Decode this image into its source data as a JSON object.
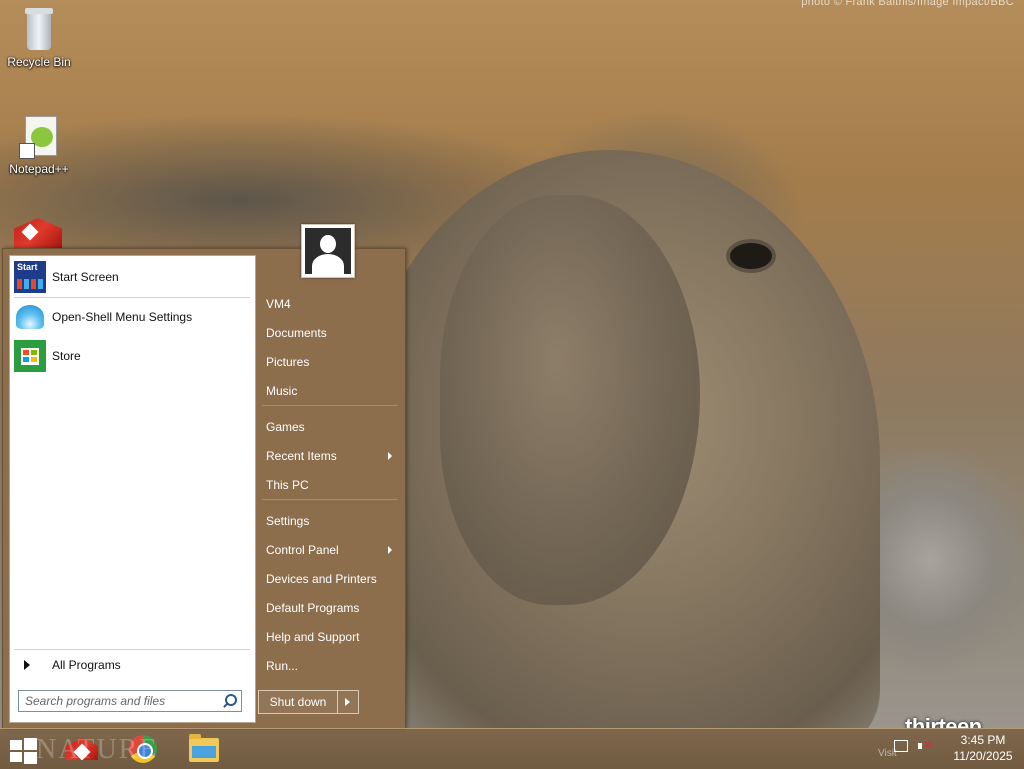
{
  "desktop": {
    "photo_credit": "photo © Frank Balthis/Image Impact/BBC",
    "watermark": "thirteen",
    "watermark_sub": "Visit",
    "nature_logo_text": "NATURE",
    "icons": [
      {
        "label": "Recycle Bin",
        "icon": "recycle-bin-icon"
      },
      {
        "label": "Notepad++",
        "icon": "notepad-plus-plus-icon"
      }
    ]
  },
  "start_menu": {
    "pinned": [
      {
        "label": "Start Screen",
        "icon": "start-screen-icon"
      },
      {
        "label": "Open-Shell Menu Settings",
        "icon": "open-shell-icon"
      },
      {
        "label": "Store",
        "icon": "store-icon"
      }
    ],
    "all_programs": "All Programs",
    "search_placeholder": "Search programs and files",
    "right_items": [
      {
        "label": "VM4",
        "submenu": false
      },
      {
        "label": "Documents",
        "submenu": false
      },
      {
        "label": "Pictures",
        "submenu": false
      },
      {
        "label": "Music",
        "submenu": false
      },
      {
        "label": "Games",
        "submenu": false
      },
      {
        "label": "Recent Items",
        "submenu": true
      },
      {
        "label": "This PC",
        "submenu": false
      },
      {
        "label": "Settings",
        "submenu": false
      },
      {
        "label": "Control Panel",
        "submenu": true
      },
      {
        "label": "Devices and Printers",
        "submenu": false
      },
      {
        "label": "Default Programs",
        "submenu": false
      },
      {
        "label": "Help and Support",
        "submenu": false
      },
      {
        "label": "Run...",
        "submenu": false
      }
    ],
    "shutdown_label": "Shut down",
    "accent_color": "#8c6d4c"
  },
  "taskbar": {
    "apps": [
      {
        "name": "nature-app-icon"
      },
      {
        "name": "chrome-icon"
      },
      {
        "name": "file-explorer-icon"
      }
    ],
    "clock_time": "3:45 PM",
    "clock_date": "11/20/2025"
  }
}
